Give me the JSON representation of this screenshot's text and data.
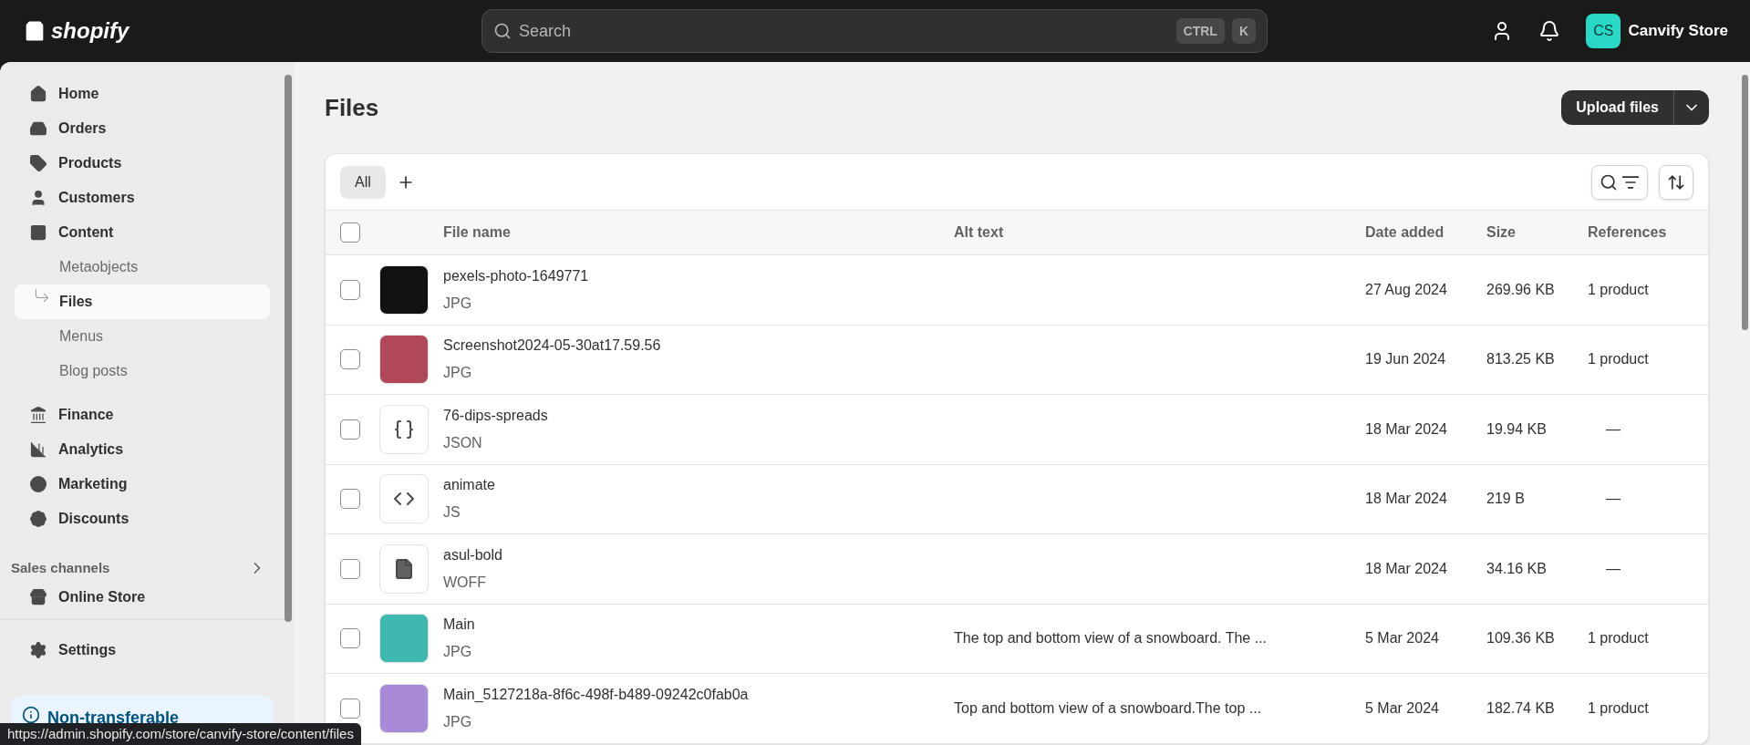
{
  "topbar": {
    "logo": "shopify",
    "search": {
      "placeholder": "Search",
      "shortcut": [
        "CTRL",
        "K"
      ]
    },
    "store": {
      "initials": "CS",
      "name": "Canvify Store"
    }
  },
  "sidebar": {
    "items": [
      {
        "label": "Home",
        "selected": false
      },
      {
        "label": "Orders",
        "selected": false
      },
      {
        "label": "Products",
        "selected": false
      },
      {
        "label": "Customers",
        "selected": false
      },
      {
        "label": "Content",
        "selected": false,
        "children": [
          {
            "label": "Metaobjects",
            "selected": false
          },
          {
            "label": "Files",
            "selected": true
          },
          {
            "label": "Menus",
            "selected": false
          },
          {
            "label": "Blog posts",
            "selected": false
          }
        ]
      },
      {
        "label": "Finance",
        "selected": false
      },
      {
        "label": "Analytics",
        "selected": false
      },
      {
        "label": "Marketing",
        "selected": false
      },
      {
        "label": "Discounts",
        "selected": false
      }
    ],
    "sales_channels": {
      "heading": "Sales channels",
      "items": [
        {
          "label": "Online Store",
          "selected": false
        }
      ]
    },
    "settings": {
      "label": "Settings",
      "selected": false
    },
    "banner": {
      "text": "Non-transferable"
    }
  },
  "page": {
    "title": "Files",
    "upload_button": "Upload files"
  },
  "tabs": [
    {
      "label": "All",
      "selected": true
    }
  ],
  "table": {
    "columns": [
      "File name",
      "Alt text",
      "Date added",
      "Size",
      "References"
    ],
    "header_checked": false,
    "rows": [
      {
        "kind": "photo",
        "color": "#111111",
        "name": "pexels-photo-1649771",
        "type": "JPG",
        "alt_text": "",
        "date": "27 Aug 2024",
        "size": "269.96 KB",
        "references": "1 product",
        "checked": false
      },
      {
        "kind": "photo",
        "color": "#b0485a",
        "name": "Screenshot2024-05-30at17.59.56",
        "type": "JPG",
        "alt_text": "",
        "date": "19 Jun 2024",
        "size": "813.25 KB",
        "references": "1 product",
        "checked": false
      },
      {
        "kind": "json",
        "name": "76-dips-spreads",
        "type": "JSON",
        "alt_text": "",
        "date": "18 Mar 2024",
        "size": "19.94 KB",
        "references": "—",
        "checked": false
      },
      {
        "kind": "js",
        "name": "animate",
        "type": "JS",
        "alt_text": "",
        "date": "18 Mar 2024",
        "size": "219 B",
        "references": "—",
        "checked": false
      },
      {
        "kind": "file",
        "name": "asul-bold",
        "type": "WOFF",
        "alt_text": "",
        "date": "18 Mar 2024",
        "size": "34.16 KB",
        "references": "—",
        "checked": false
      },
      {
        "kind": "photo",
        "color": "#3fb8b0",
        "name": "Main",
        "type": "JPG",
        "alt_text": "The top and bottom view of a snowboard. The ...",
        "date": "5 Mar 2024",
        "size": "109.36 KB",
        "references": "1 product",
        "checked": false
      },
      {
        "kind": "photo",
        "color": "#a88ad8",
        "name": "Main_5127218a-8f6c-498f-b489-09242c0fab0a",
        "type": "JPG",
        "alt_text": "Top and bottom view of a snowboard.The top ...",
        "date": "5 Mar 2024",
        "size": "182.74 KB",
        "references": "1 product",
        "checked": false
      }
    ]
  },
  "status_url": "https://admin.shopify.com/store/canvify-store/content/files"
}
